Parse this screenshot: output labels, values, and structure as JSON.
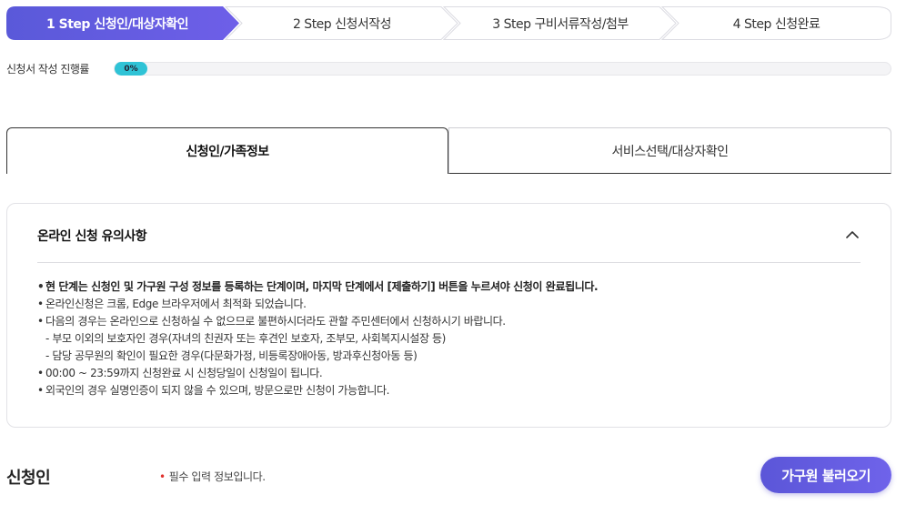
{
  "steps": [
    {
      "label": "1 Step 신청인/대상자확인",
      "active": true
    },
    {
      "label": "2 Step 신청서작성",
      "active": false
    },
    {
      "label": "3 Step 구비서류작성/첨부",
      "active": false
    },
    {
      "label": "4 Step 신청완료",
      "active": false
    }
  ],
  "progress": {
    "label": "신청서 작성 진행률",
    "value_text": "0%",
    "value": 0
  },
  "tabs": [
    {
      "label": "신청인/가족정보",
      "active": true
    },
    {
      "label": "서비스선택/대상자확인",
      "active": false
    }
  ],
  "notice": {
    "title": "온라인 신청 유의사항",
    "chevron": "chevron-up-icon",
    "items": [
      "현 단계는 신청인 및 가구원 구성 정보를 등록하는 단계이며, 마지막 단계에서 [제출하기] 버튼을 누르셔야 신청이 완료됩니다.",
      "온라인신청은 크롬, Edge 브라우저에서 최적화 되었습니다.",
      "다음의 경우는 온라인으로 신청하실 수 없으므로 불편하시더라도 관할 주민센터에서 신청하시기 바랍니다.",
      "- 부모 이외의 보호자인 경우(자녀의 친권자 또는 후견인 보호자, 조부모, 사회복지시설장 등)",
      "- 담당 공무원의 확인이 필요한 경우(다문화가정, 비등록장애아동, 방과후신청아동 등)",
      "00:00 ~ 23:59까지 신청완료 시 신청당일이 신청일이 됩니다.",
      "외국인의 경우 실명인증이 되지 않을 수 있으며, 방문으로만 신청이 가능합니다."
    ]
  },
  "applicant": {
    "title": "신청인",
    "required_note": "필수 입력 정보입니다.",
    "family_button": "가구원 불러오기"
  },
  "colors": {
    "accent": "#5b56d8",
    "progress": "#2fc3d6",
    "required": "#e0322e"
  }
}
